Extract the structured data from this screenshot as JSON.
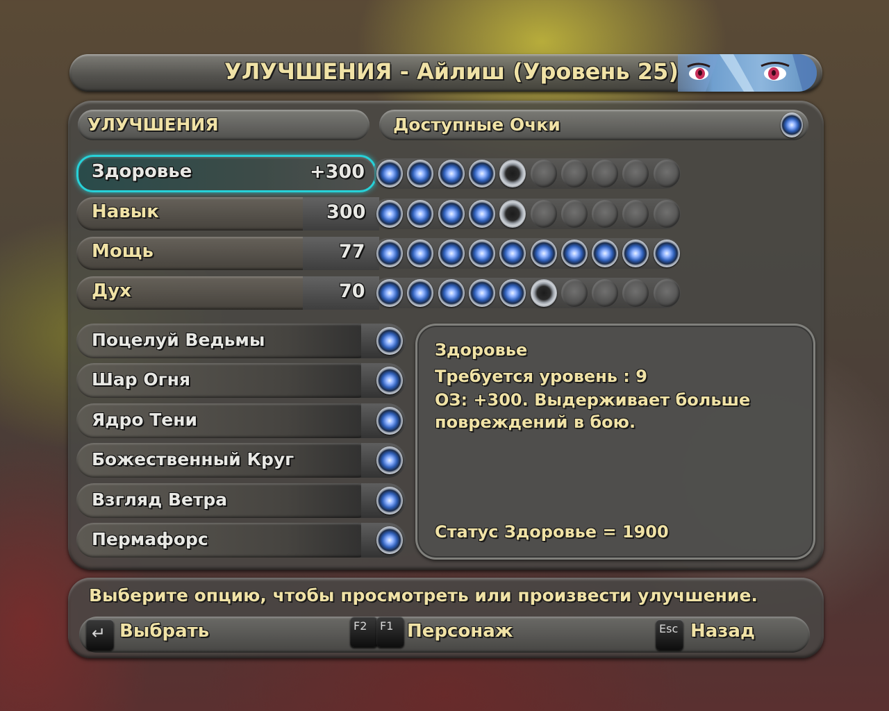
{
  "title": "УЛУЧШЕНИЯ - Айлиш (Уровень 25)",
  "headers": {
    "upgrades": "УЛУЧШЕНИЯ",
    "available_points": "Доступные Очки",
    "available_points_count": 1
  },
  "stats": [
    {
      "name": "Здоровье",
      "value": "+300",
      "filled": 4,
      "empty_outlined": 1,
      "total": 10,
      "selected": true
    },
    {
      "name": "Навык",
      "value": "300",
      "filled": 4,
      "empty_outlined": 1,
      "total": 10,
      "selected": false
    },
    {
      "name": "Мощь",
      "value": "77",
      "filled": 10,
      "empty_outlined": 0,
      "total": 10,
      "selected": false
    },
    {
      "name": "Дух",
      "value": "70",
      "filled": 5,
      "empty_outlined": 1,
      "total": 10,
      "selected": false
    }
  ],
  "skills": [
    {
      "name": "Поцелуй Ведьмы"
    },
    {
      "name": "Шар Огня"
    },
    {
      "name": "Ядро Тени"
    },
    {
      "name": "Божественный Круг"
    },
    {
      "name": "Взгляд Ветра"
    },
    {
      "name": "Пермафорс"
    }
  ],
  "info": {
    "title": "Здоровье",
    "requirement": "Требуется уровень : 9",
    "description_line1": "ОЗ: +300. Выдерживает больше",
    "description_line2": "повреждений в бою.",
    "status": "Статус Здоровье = 1900"
  },
  "hint": "Выберите опцию, чтобы просмотреть или произвести улучшение.",
  "controls": {
    "select_key": "↵",
    "select_label": "Выбрать",
    "char_key1": "F2",
    "char_key2": "F1",
    "char_label": "Персонаж",
    "back_key": "Esc",
    "back_label": "Назад"
  },
  "colors": {
    "text_gold": "#f0e2a6",
    "highlight_cyan": "#27d1d8",
    "orb_blue": "#2f5fb8"
  }
}
